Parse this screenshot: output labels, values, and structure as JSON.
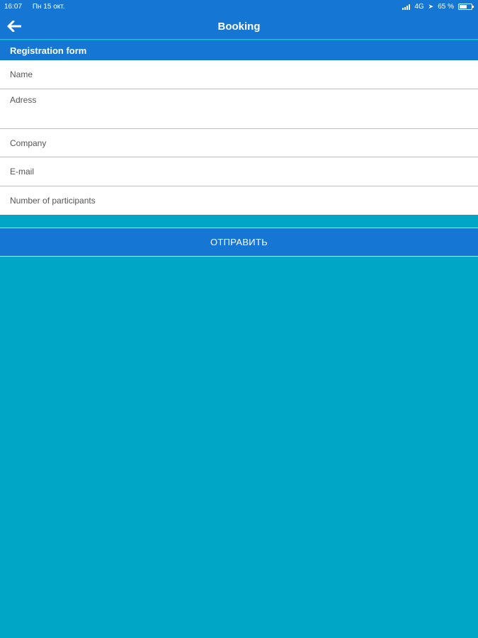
{
  "status_bar": {
    "time": "16:07",
    "date": "Пн 15 окт.",
    "network": "4G",
    "battery": "65 %",
    "battery_level": 0.65
  },
  "navbar": {
    "back_icon": "arrow-left-icon",
    "title": "Booking"
  },
  "section": {
    "title": "Registration form"
  },
  "form": {
    "name_placeholder": "Name",
    "adress_placeholder": "Adress",
    "company_placeholder": "Company",
    "email_placeholder": "E-mail",
    "participants_placeholder": "Number of participants"
  },
  "submit": {
    "label": "ОТПРАВИТЬ"
  },
  "colors": {
    "primary": "#1676D3",
    "background": "#00A6C6",
    "form_background": "#FFFFFF"
  }
}
